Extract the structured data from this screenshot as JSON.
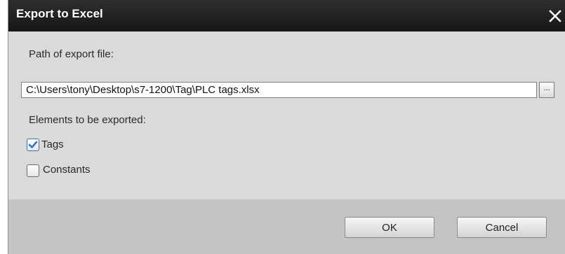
{
  "dialog": {
    "title": "Export to Excel",
    "path_label": "Path of export file:",
    "path_value": "C:\\Users\\tony\\Desktop\\s7-1200\\Tag\\PLC tags.xlsx",
    "browse_label": "...",
    "elements_label": "Elements to be exported:",
    "options": [
      {
        "label": "Tags",
        "checked": true
      },
      {
        "label": "Constants",
        "checked": false
      }
    ],
    "ok_label": "OK",
    "cancel_label": "Cancel"
  },
  "icons": {
    "close": "close-icon",
    "check": "checkmark-icon"
  },
  "colors": {
    "titlebar": "#1f1f1f",
    "checkmark": "#3b73b9"
  }
}
